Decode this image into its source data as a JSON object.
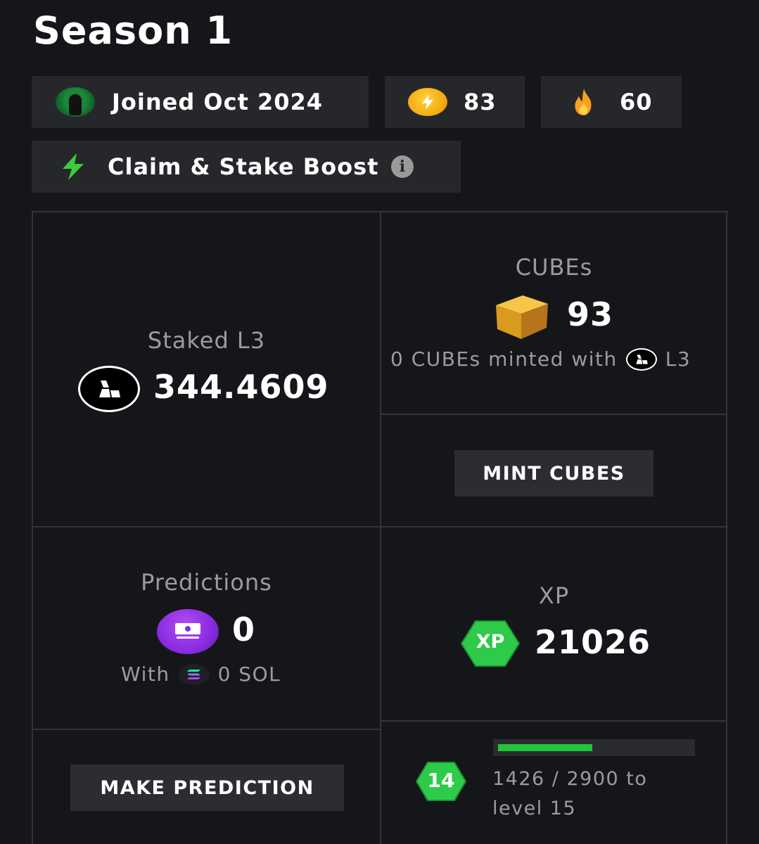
{
  "header": {
    "title": "Season 1"
  },
  "chips": {
    "joined": "Joined Oct 2024",
    "bolt_count": "83",
    "fire_count": "60",
    "boost_label": "Claim & Stake Boost"
  },
  "staked": {
    "label": "Staked L3",
    "value": "344.4609"
  },
  "cubes": {
    "label": "CUBEs",
    "value": "93",
    "sub_prefix": "0 CUBEs minted with",
    "sub_token": "L3",
    "mint_button": "MINT CUBES"
  },
  "predictions": {
    "label": "Predictions",
    "value": "0",
    "sub_prefix": "With",
    "sub_value": "0 SOL",
    "button": "MAKE PREDICTION"
  },
  "xp": {
    "label": "XP",
    "badge": "XP",
    "value": "21026",
    "level": "14",
    "progress_text_line1": "1426 / 2900 to",
    "progress_text_line2": "level 15",
    "progress_fraction": 0.492
  },
  "colors": {
    "background": "#15161a",
    "chip": "#26272b",
    "accent_green": "#22c53a",
    "coin_yellow": "#f2a70f",
    "purple": "#8a2be2"
  }
}
